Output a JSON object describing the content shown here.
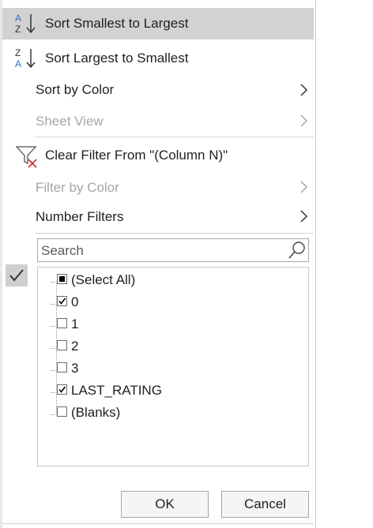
{
  "menu": {
    "sort_asc": "Sort Smallest to Largest",
    "sort_desc": "Sort Largest to Smallest",
    "sort_by_color": "Sort by Color",
    "sheet_view": "Sheet View",
    "clear_filter": "Clear Filter From \"(Column N)\"",
    "filter_by_color": "Filter by Color",
    "number_filters": "Number Filters"
  },
  "search": {
    "placeholder": "Search"
  },
  "values": [
    {
      "label": "(Select All)",
      "state": "partial"
    },
    {
      "label": "0",
      "state": "checked"
    },
    {
      "label": "1",
      "state": "unchecked"
    },
    {
      "label": "2",
      "state": "unchecked"
    },
    {
      "label": "3",
      "state": "unchecked"
    },
    {
      "label": "LAST_RATING",
      "state": "checked"
    },
    {
      "label": "(Blanks)",
      "state": "unchecked"
    }
  ],
  "buttons": {
    "ok": "OK",
    "cancel": "Cancel"
  },
  "icons": {
    "sort_asc": "sort-a-to-z-icon",
    "sort_desc": "sort-z-to-a-icon",
    "clear_filter": "clear-filter-icon",
    "search": "search-icon",
    "gutter": "checkmark-icon"
  },
  "colors": {
    "highlight": "#d2d2d2",
    "accent_blue": "#2b6cc4",
    "clear_red": "#d13438",
    "disabled_text": "#a6a6a6"
  }
}
